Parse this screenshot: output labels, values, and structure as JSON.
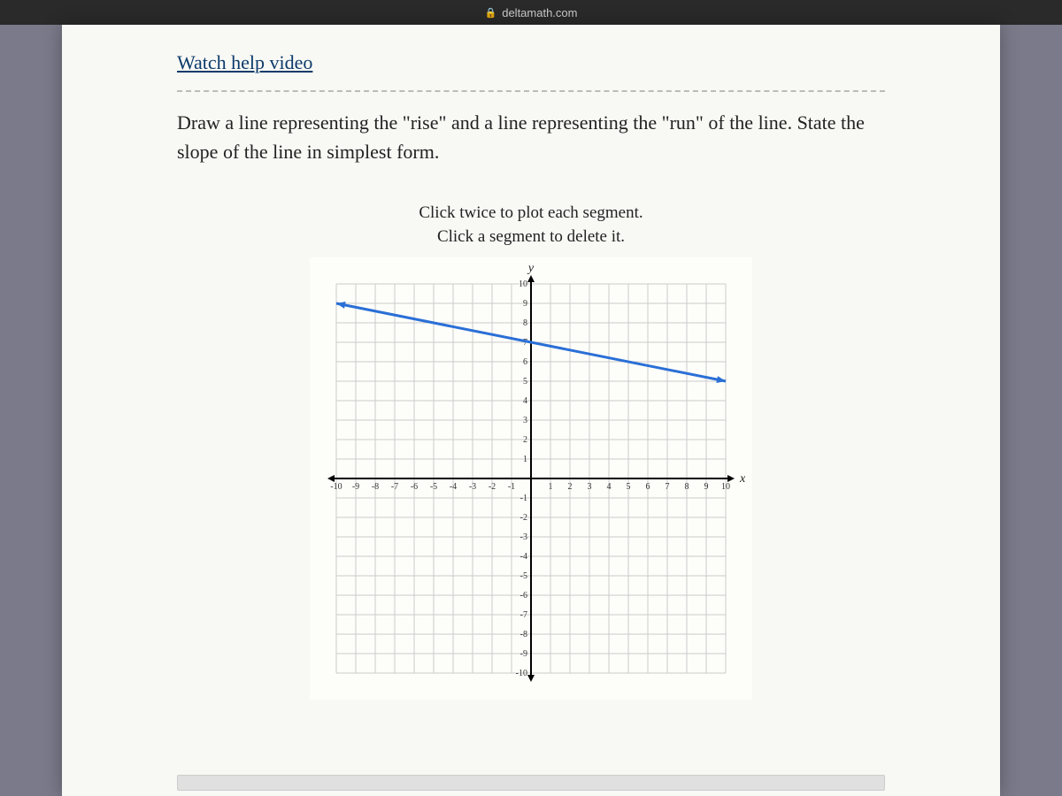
{
  "browser": {
    "domain": "deltamath.com"
  },
  "help_link": "Watch help video",
  "question_text": "Draw a line representing the \"rise\" and a line representing the \"run\" of the line. State the slope of the line in simplest form.",
  "instructions_line1": "Click twice to plot each segment.",
  "instructions_line2": "Click a segment to delete it.",
  "chart_data": {
    "type": "line",
    "xlabel": "x",
    "ylabel": "y",
    "xlim": [
      -10,
      10
    ],
    "ylim": [
      -10,
      10
    ],
    "x_ticks": [
      -10,
      -9,
      -8,
      -7,
      -6,
      -5,
      -4,
      -3,
      -2,
      -1,
      1,
      2,
      3,
      4,
      5,
      6,
      7,
      8,
      9,
      10
    ],
    "y_ticks": [
      -10,
      -9,
      -8,
      -7,
      -6,
      -5,
      -4,
      -3,
      -2,
      -1,
      1,
      2,
      3,
      4,
      5,
      6,
      7,
      8,
      9,
      10
    ],
    "series": [
      {
        "name": "plotted-line",
        "points": [
          [
            -10,
            9
          ],
          [
            10,
            5
          ]
        ]
      }
    ]
  }
}
